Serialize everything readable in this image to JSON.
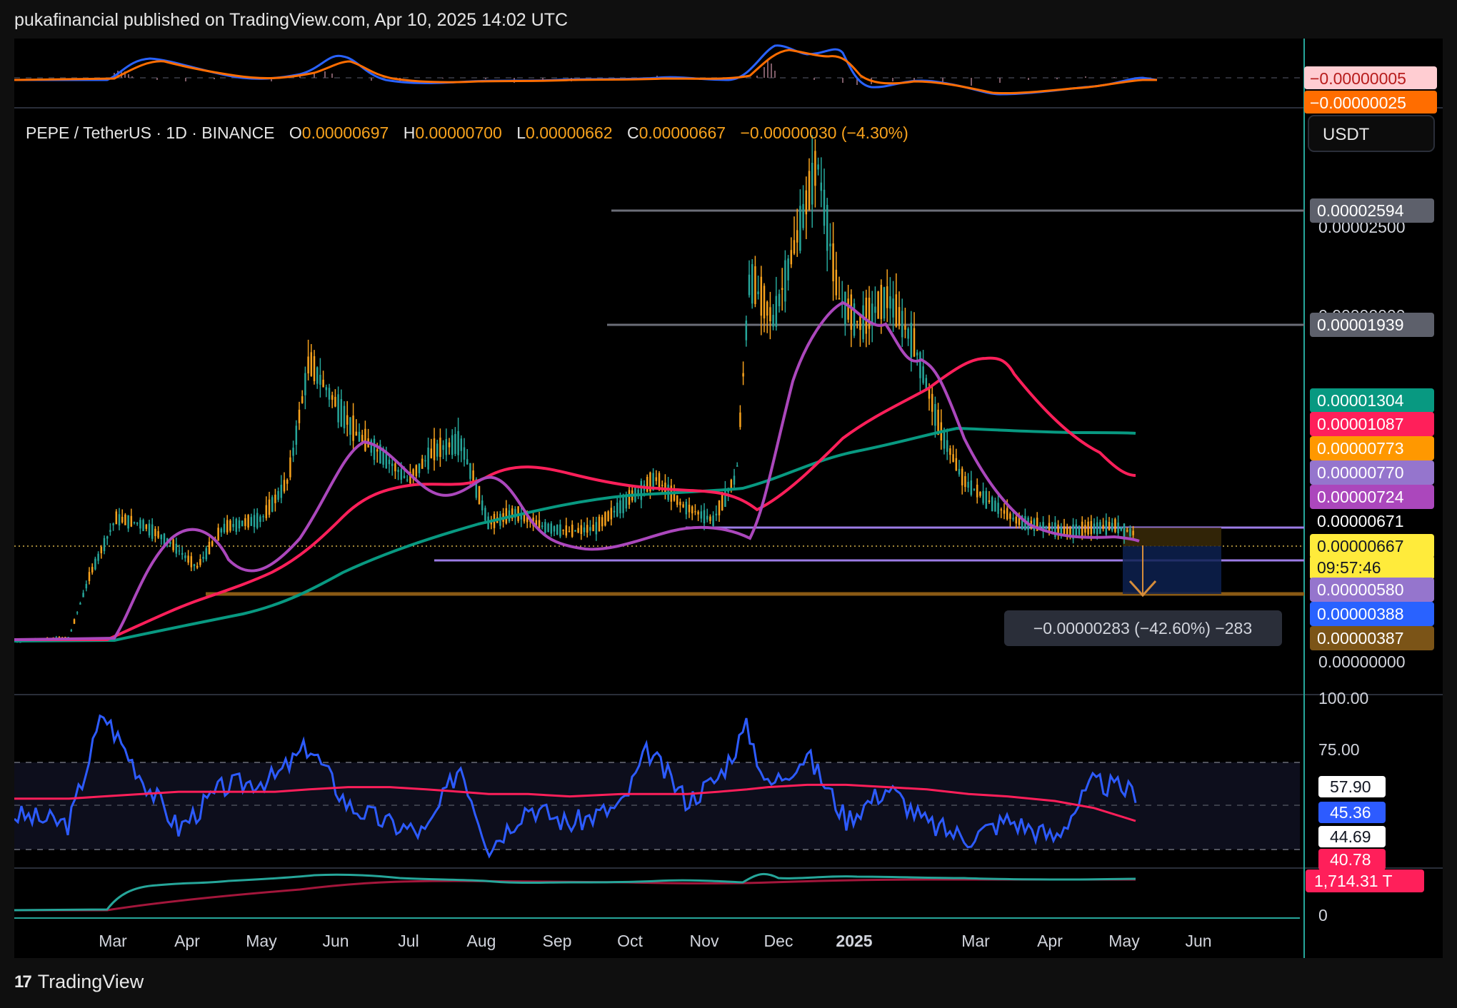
{
  "header": {
    "publisher": "pukafinancial published on TradingView.com, Apr 10, 2025 14:02 UTC"
  },
  "legend": {
    "symbol": "PEPE / TetherUS · 1D · BINANCE",
    "o_label": "O",
    "o_value": "0.00000697",
    "h_label": "H",
    "h_value": "0.00000700",
    "l_label": "L",
    "l_value": "0.00000662",
    "c_label": "C",
    "c_value": "0.00000667",
    "change": "−0.00000030 (−4.30%)"
  },
  "currency_button": "USDT",
  "measure_label": "−0.00000283 (−42.60%) −283",
  "colors": {
    "background": "#000000",
    "ma_fast": "#ab47bc",
    "ma_mid": "#ff1f5a",
    "ma_slow": "#089981",
    "level_gray": "#5d606b",
    "level_purple": "#9c7ce6",
    "level_orange": "#8a5a14",
    "rsi": "#2d5bff",
    "rsi_ma": "#ff1f5a",
    "macd_line": "#2962ff",
    "signal_line": "#ff6d00",
    "obv": "#26a69a",
    "obv_ma": "#b71c3c"
  },
  "price_scale": {
    "ticks": [
      "0.00002500",
      "0.00002000",
      "0.00000000"
    ],
    "labels": [
      {
        "text": "0.00002594",
        "bg": "#5d606b",
        "fg": "#ffffff"
      },
      {
        "text": "0.00001939",
        "bg": "#5d606b",
        "fg": "#ffffff"
      },
      {
        "text": "0.00001304",
        "bg": "#089981",
        "fg": "#ffffff"
      },
      {
        "text": "0.00001087",
        "bg": "#ff1f5a",
        "fg": "#ffffff"
      },
      {
        "text": "0.00000773",
        "bg": "#ff9800",
        "fg": "#ffffff"
      },
      {
        "text": "0.00000770",
        "bg": "#9575cd",
        "fg": "#ffffff"
      },
      {
        "text": "0.00000724",
        "bg": "#ab47bc",
        "fg": "#ffffff"
      },
      {
        "text": "0.00000671",
        "bg": "#000000",
        "fg": "#ffffff"
      },
      {
        "text": "0.00000667",
        "bg": "#ffeb3b",
        "fg": "#131722"
      },
      {
        "text": "09:57:46",
        "bg": "#ffeb3b",
        "fg": "#131722"
      },
      {
        "text": "0.00000580",
        "bg": "#9575cd",
        "fg": "#ffffff"
      },
      {
        "text": "0.00000388",
        "bg": "#2962ff",
        "fg": "#ffffff"
      },
      {
        "text": "0.00000387",
        "bg": "#7b5417",
        "fg": "#ffffff"
      }
    ]
  },
  "macd_pane": {
    "labels": [
      {
        "text": "−0.00000005",
        "bg": "#ffcdd2",
        "fg": "#b71c1c"
      },
      {
        "text": "−0.00000025",
        "bg": "#ff6d00",
        "fg": "#ffffff"
      }
    ]
  },
  "rsi_pane": {
    "ticks": [
      "100.00",
      "75.00"
    ],
    "labels": [
      {
        "text": "57.90",
        "bg": "#ffffff",
        "fg": "#131722"
      },
      {
        "text": "45.36",
        "bg": "#2d5bff",
        "fg": "#ffffff"
      },
      {
        "text": "44.69",
        "bg": "#ffffff",
        "fg": "#131722"
      },
      {
        "text": "40.78",
        "bg": "#ff1f5a",
        "fg": "#ffffff"
      }
    ]
  },
  "volume_pane": {
    "tick": "0",
    "labels": [
      {
        "text": "1,714.31 T",
        "bg": "#ff1f5a",
        "fg": "#ffffff"
      }
    ]
  },
  "time_axis": {
    "labels": [
      "Mar",
      "Apr",
      "May",
      "Jun",
      "Jul",
      "Aug",
      "Sep",
      "Oct",
      "Nov",
      "Dec",
      "2025",
      "Mar",
      "Apr",
      "May",
      "Jun"
    ]
  },
  "footer": {
    "brand": "TradingView",
    "logo": "17"
  },
  "chart_data": {
    "type": "line",
    "symbol": "PEPE/USDT",
    "x": [
      "2024-02-05",
      "2024-02-26",
      "2024-03-05",
      "2024-03-15",
      "2024-03-25",
      "2024-04-05",
      "2024-04-15",
      "2024-04-25",
      "2024-05-10",
      "2024-05-20",
      "2024-05-28",
      "2024-06-05",
      "2024-06-15",
      "2024-06-25",
      "2024-07-05",
      "2024-07-15",
      "2024-07-25",
      "2024-08-05",
      "2024-08-15",
      "2024-08-25",
      "2024-09-05",
      "2024-09-15",
      "2024-09-28",
      "2024-10-08",
      "2024-10-18",
      "2024-10-30",
      "2024-11-08",
      "2024-11-13",
      "2024-11-22",
      "2024-12-01",
      "2024-12-09",
      "2024-12-17",
      "2024-12-25",
      "2025-01-05",
      "2025-01-15",
      "2025-01-25",
      "2025-02-03",
      "2025-02-13",
      "2025-02-23",
      "2025-03-05",
      "2025-03-15",
      "2025-03-25",
      "2025-04-02",
      "2025-04-10"
    ],
    "series": [
      {
        "values": [
          9.5e-07,
          1.2e-06,
          4.5e-06,
          7.5e-06,
          7.2e-06,
          6.2e-06,
          4.9e-06,
          7e-06,
          7.5e-06,
          9.5e-06,
          1.58e-05,
          1.41e-05,
          1.2e-05,
          1.09e-05,
          9.5e-06,
          1.11e-05,
          1.16e-05,
          7.2e-06,
          7.8e-06,
          7.1e-06,
          6.8e-06,
          7e-06,
          8.6e-06,
          9.6e-06,
          8.2e-06,
          7.4e-06,
          9.8e-06,
          2.03e-05,
          1.8e-05,
          2.23e-05,
          2.64e-05,
          1.92e-05,
          1.78e-05,
          1.92e-05,
          1.68e-05,
          1.22e-05,
          9.5e-06,
          8.4e-06,
          7.4e-06,
          7.1e-06,
          6.8e-06,
          7e-06,
          7.1e-06,
          6.67e-06
        ]
      },
      {
        "values": [
          9e-07,
          1e-06,
          3.2e-06,
          5.8e-06,
          6.5e-06,
          6.1e-06,
          5.5e-06,
          5.9e-06,
          7.1e-06,
          9.8e-06,
          1.22e-05,
          1.2e-05,
          1.08e-05,
          9.7e-06,
          9e-06,
          1.04e-05,
          1.08e-05,
          8.2e-06,
          7.3e-06,
          6.9e-06,
          6.8e-06,
          7.1e-06,
          8e-06,
          8.3e-06,
          8.1e-06,
          7.5e-06,
          9.6e-06,
          1.58e-05,
          2.05e-05,
          2.16e-05,
          2.18e-05,
          2.02e-05,
          1.87e-05,
          1.78e-05,
          1.64e-05,
          1.32e-05,
          1.05e-05,
          8.9e-06,
          7.8e-06,
          7.2e-06,
          6.9e-06,
          7.1e-06,
          7.2e-06,
          7.24e-06
        ]
      },
      {
        "values": [
          9e-07,
          9e-07,
          1.5e-06,
          3e-06,
          4e-06,
          4.8e-06,
          5.2e-06,
          5.6e-06,
          6.2e-06,
          7.1e-06,
          8.1e-06,
          9e-06,
          9.4e-06,
          9.6e-06,
          9.7e-06,
          9.9e-06,
          9.9e-06,
          9.6e-06,
          9.2e-06,
          8.8e-06,
          8.5e-06,
          8.4e-06,
          8.5e-06,
          8.6e-06,
          8.4e-06,
          8.1e-06,
          8.5e-06,
          1e-05,
          1.18e-05,
          1.34e-05,
          1.5e-05,
          1.58e-05,
          1.64e-05,
          1.7e-05,
          1.75e-05,
          1.76e-05,
          1.7e-05,
          1.59e-05,
          1.45e-05,
          1.32e-05,
          1.2e-05,
          1.14e-05,
          1.11e-05,
          1.087e-05
        ]
      },
      {
        "values": [
          9e-07,
          9e-07,
          1.2e-06,
          1.8e-06,
          2.3e-06,
          2.8e-06,
          3.2e-06,
          3.6e-06,
          4e-06,
          4.6e-06,
          5.3e-06,
          6e-06,
          6.6e-06,
          7.1e-06,
          7.6e-06,
          8e-06,
          8.3e-06,
          8.5e-06,
          8.6e-06,
          8.7e-06,
          8.8e-06,
          8.9e-06,
          9e-06,
          9.2e-06,
          9.3e-06,
          9.3e-06,
          9.5e-06,
          1.01e-05,
          1.08e-05,
          1.15e-05,
          1.21e-05,
          1.25e-05,
          1.28e-05,
          1.32e-05,
          1.34e-05,
          1.33e-05,
          1.32e-05,
          1.31e-05,
          1.31e-05,
          1.31e-05,
          1.31e-05,
          1.3e-05,
          1.3e-05,
          1.304e-05
        ]
      }
    ],
    "levels": [
      2.594e-05,
      1.939e-05,
      6.71e-06,
      5.8e-06,
      3.87e-06
    ],
    "target": {
      "from": 6.71e-06,
      "to": 3.88e-06,
      "change": "−0.00000283 (−42.60%)",
      "ticks": -283
    },
    "ylim": [
      0,
      2.8e-05
    ],
    "grid": false,
    "rsi": {
      "x": [
        "2024-02-05",
        "2024-02-26",
        "2024-03-10",
        "2024-03-25",
        "2024-04-08",
        "2024-04-25",
        "2024-05-15",
        "2024-05-28",
        "2024-06-12",
        "2024-06-28",
        "2024-07-12",
        "2024-07-25",
        "2024-08-05",
        "2024-08-20",
        "2024-09-05",
        "2024-09-25",
        "2024-10-05",
        "2024-10-20",
        "2024-11-01",
        "2024-11-12",
        "2024-11-20",
        "2024-12-05",
        "2024-12-20",
        "2025-01-05",
        "2025-01-20",
        "2025-02-05",
        "2025-02-20",
        "2025-03-10",
        "2025-03-25",
        "2025-04-10"
      ],
      "values": [
        48,
        44,
        92,
        64,
        42,
        60,
        64,
        78,
        52,
        44,
        40,
        70,
        34,
        52,
        44,
        52,
        76,
        54,
        64,
        86,
        60,
        74,
        46,
        60,
        44,
        38,
        46,
        38,
        62,
        57.9
      ],
      "ma_values": [
        55,
        55,
        56,
        57,
        58,
        58,
        58,
        59,
        60,
        60,
        59,
        58,
        57,
        57,
        56,
        57,
        57,
        57,
        58,
        59,
        60,
        61,
        61,
        60,
        59,
        57,
        56,
        54,
        51,
        45.36
      ],
      "bands": [
        70,
        50,
        30
      ],
      "ylim": [
        25,
        100
      ]
    }
  }
}
